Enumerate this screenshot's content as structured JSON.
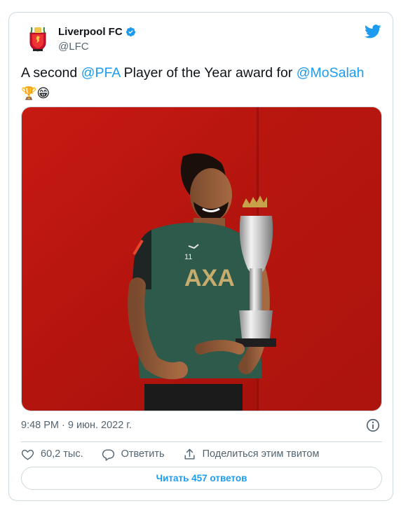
{
  "author": {
    "name": "Liverpool FC",
    "handle": "@LFC",
    "verified": true,
    "avatar_icon": "lfc-crest-icon",
    "crest_text": "LIVERPOOL FOOTBALL CLUB"
  },
  "tweet": {
    "text_before": "A second ",
    "mention_1": "@PFA",
    "text_middle": " Player of the Year award for ",
    "mention_2": "@MoSalah",
    "emoji_1": "🏆",
    "emoji_2": "😁",
    "image_alt": "Mohamed Salah holding the PFA Player of the Year trophy",
    "shirt_number": "11",
    "shirt_sponsor": "AXA"
  },
  "meta": {
    "timestamp": "9:48 PM · 9 июн. 2022 г."
  },
  "actions": {
    "likes": "60,2 тыс.",
    "reply_label": "Ответить",
    "share_label": "Поделиться этим твитом"
  },
  "replies_button": "Читать 457 ответов",
  "colors": {
    "accent": "#1d9bf0",
    "text": "#0f1419",
    "secondary": "#536471",
    "border": "#cfd9de",
    "photo_bg": "#b5150f",
    "shirt": "#2e5a4c"
  }
}
